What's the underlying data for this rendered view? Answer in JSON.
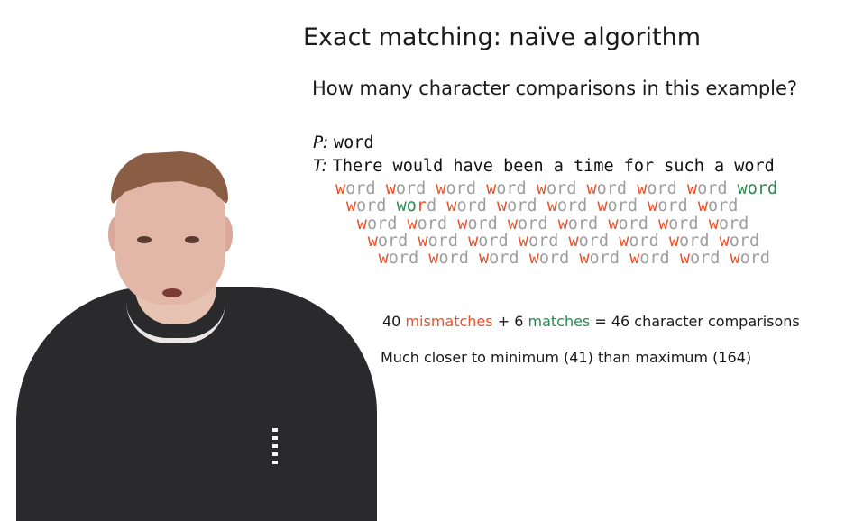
{
  "slide": {
    "title": "Exact matching: naïve algorithm",
    "subtitle": "How many character comparisons in this example?"
  },
  "pattern": {
    "label": "P:",
    "value": "word"
  },
  "text": {
    "label": "T:",
    "value": "There would have been a time for such a word"
  },
  "alignment_rows": [
    [
      {
        "mm": "w",
        "rest": "ord"
      },
      {
        "mm": "w",
        "rest": "ord"
      },
      {
        "mm": "w",
        "rest": "ord"
      },
      {
        "mm": "w",
        "rest": "ord"
      },
      {
        "mm": "w",
        "rest": "ord"
      },
      {
        "mm": "w",
        "rest": "ord"
      },
      {
        "mm": "w",
        "rest": "ord"
      },
      {
        "mm": "w",
        "rest": "ord"
      },
      {
        "ok": "word",
        "rest": ""
      }
    ],
    [
      {
        "mm": "w",
        "rest": "ord"
      },
      {
        "ok": "wo",
        "mm": "r",
        "rest": "d"
      },
      {
        "mm": "w",
        "rest": "ord"
      },
      {
        "mm": "w",
        "rest": "ord"
      },
      {
        "mm": "w",
        "rest": "ord"
      },
      {
        "mm": "w",
        "rest": "ord"
      },
      {
        "mm": "w",
        "rest": "ord"
      },
      {
        "mm": "w",
        "rest": "ord"
      }
    ],
    [
      {
        "mm": "w",
        "rest": "ord"
      },
      {
        "mm": "w",
        "rest": "ord"
      },
      {
        "mm": "w",
        "rest": "ord"
      },
      {
        "mm": "w",
        "rest": "ord"
      },
      {
        "mm": "w",
        "rest": "ord"
      },
      {
        "mm": "w",
        "rest": "ord"
      },
      {
        "mm": "w",
        "rest": "ord"
      },
      {
        "mm": "w",
        "rest": "ord"
      }
    ],
    [
      {
        "mm": "w",
        "rest": "ord"
      },
      {
        "mm": "w",
        "rest": "ord"
      },
      {
        "mm": "w",
        "rest": "ord"
      },
      {
        "mm": "w",
        "rest": "ord"
      },
      {
        "mm": "w",
        "rest": "ord"
      },
      {
        "mm": "w",
        "rest": "ord"
      },
      {
        "mm": "w",
        "rest": "ord"
      },
      {
        "mm": "w",
        "rest": "ord"
      }
    ],
    [
      {
        "mm": "w",
        "rest": "ord"
      },
      {
        "mm": "w",
        "rest": "ord"
      },
      {
        "mm": "w",
        "rest": "ord"
      },
      {
        "mm": "w",
        "rest": "ord"
      },
      {
        "mm": "w",
        "rest": "ord"
      },
      {
        "mm": "w",
        "rest": "ord"
      },
      {
        "mm": "w",
        "rest": "ord"
      },
      {
        "mm": "w",
        "rest": "ord"
      }
    ]
  ],
  "summary": {
    "mismatch_count": "40",
    "mismatch_word": "mismatches",
    "plus": "+",
    "match_count": "6",
    "match_word": "matches",
    "equals": "=",
    "total": "46 character comparisons"
  },
  "note": "Much closer to minimum (41) than maximum (164)",
  "colors": {
    "mismatch": "#e8532b",
    "match": "#2a8a52",
    "unexamined": "#9e9e9e"
  }
}
